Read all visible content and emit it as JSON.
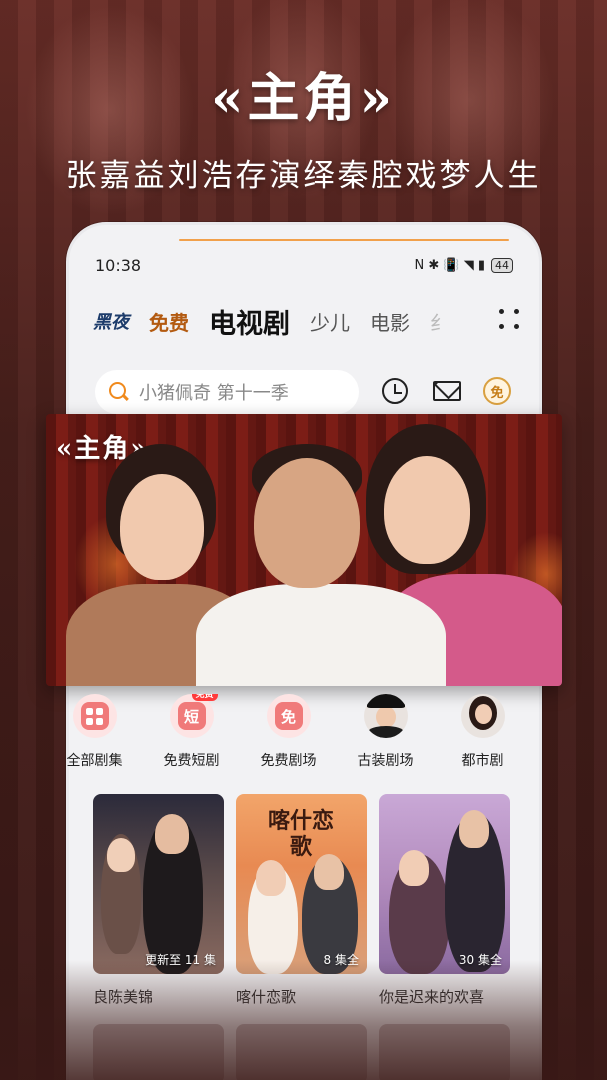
{
  "promo": {
    "headline": "«主角»",
    "subheadline": "张嘉益刘浩存演绎秦腔戏梦人生"
  },
  "statusbar": {
    "time": "10:38",
    "icons": "N ✱ 📳 ◥ ▮",
    "battery": "44"
  },
  "tabs": [
    {
      "label": "黑夜"
    },
    {
      "label": "免费"
    },
    {
      "label": "电视剧"
    },
    {
      "label": "少儿"
    },
    {
      "label": "电影"
    },
    {
      "label": "纟"
    }
  ],
  "search": {
    "placeholder": "小猪佩奇 第十一季"
  },
  "header_icons": {
    "free_badge": "免"
  },
  "banner": {
    "logo": "«主角»"
  },
  "categories": [
    {
      "label": "全部剧集",
      "icon": "grid-icon"
    },
    {
      "label": "免费短剧",
      "icon": "short-drama-icon",
      "glyph": "短",
      "badge": "免费"
    },
    {
      "label": "免费剧场",
      "icon": "free-theater-icon",
      "glyph": "免"
    },
    {
      "label": "古装剧场",
      "icon": "costume-avatar"
    },
    {
      "label": "都市剧",
      "icon": "urban-avatar"
    }
  ],
  "cards": [
    {
      "title": "良陈美锦",
      "episodes": "更新至 11 集"
    },
    {
      "title": "喀什恋歌",
      "episodes": "8 集全",
      "poster_text": "喀什恋歌"
    },
    {
      "title": "你是迟来的欢喜",
      "episodes": "30 集全"
    }
  ],
  "colors": {
    "background": "#3a1916",
    "accent": "#f08a1d",
    "free_tab": "#b35a10"
  }
}
